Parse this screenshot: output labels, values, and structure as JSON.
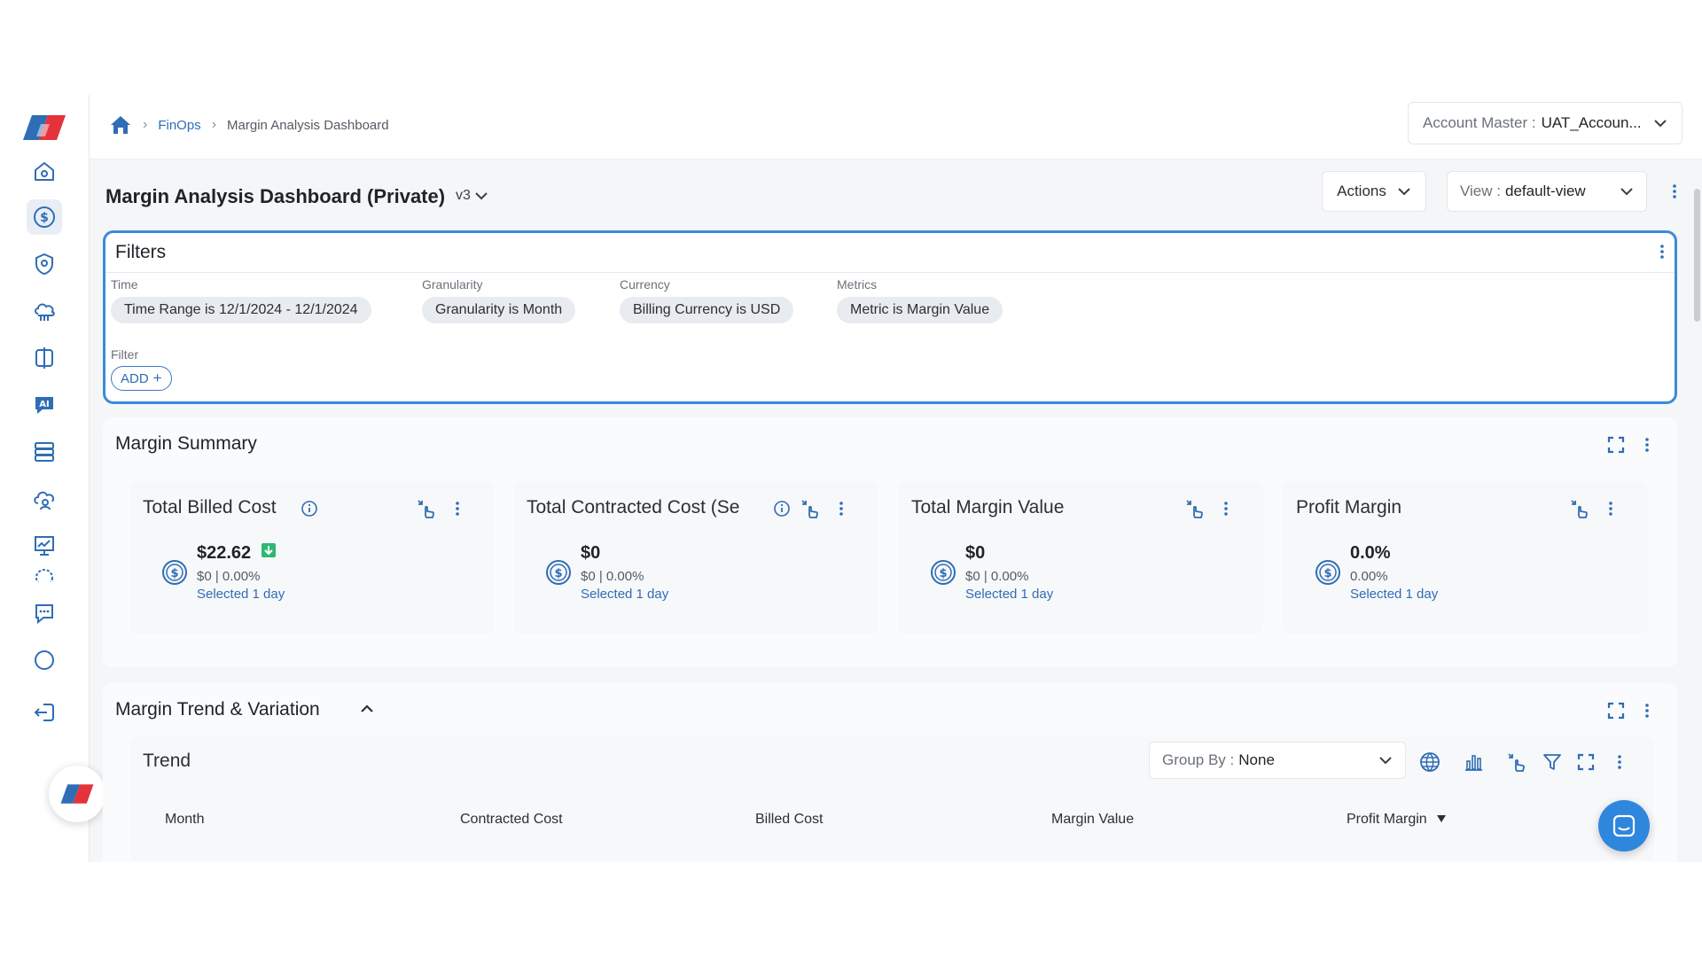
{
  "breadcrumb": {
    "items": [
      "FinOps",
      "Margin Analysis Dashboard"
    ]
  },
  "account": {
    "label": "Account Master :",
    "value": "UAT_Accoun..."
  },
  "page": {
    "title": "Margin Analysis Dashboard (Private)",
    "version": "v3"
  },
  "actions": {
    "label": "Actions"
  },
  "view": {
    "label": "View :",
    "value": "default-view"
  },
  "filters": {
    "title": "Filters",
    "groups": [
      {
        "label": "Time",
        "chip": "Time Range is 12/1/2024 - 12/1/2024"
      },
      {
        "label": "Granularity",
        "chip": "Granularity is Month"
      },
      {
        "label": "Currency",
        "chip": "Billing Currency is USD"
      },
      {
        "label": "Metrics",
        "chip": "Metric is Margin Value"
      }
    ],
    "filter_label": "Filter",
    "add_label": "ADD"
  },
  "summary": {
    "title": "Margin Summary",
    "cards": [
      {
        "title": "Total Billed Cost",
        "value": "$22.62",
        "sub": "$0 | 0.00%",
        "link": "Selected 1 day"
      },
      {
        "title": "Total Contracted Cost (Se",
        "value": "$0",
        "sub": "$0 | 0.00%",
        "link": "Selected 1 day"
      },
      {
        "title": "Total Margin Value",
        "value": "$0",
        "sub": "$0 | 0.00%",
        "link": "Selected 1 day"
      },
      {
        "title": "Profit Margin",
        "value": "0.0%",
        "sub": "0.00%",
        "link": "Selected 1 day"
      }
    ]
  },
  "trend_section": {
    "title": "Margin Trend & Variation",
    "trend_title": "Trend",
    "group_by": {
      "label": "Group By :",
      "value": "None"
    },
    "columns": [
      "Month",
      "Contracted Cost",
      "Billed Cost",
      "Margin Value",
      "Profit Margin"
    ]
  },
  "colors": {
    "accent": "#2f6db5",
    "focus_border": "#3b8ad9",
    "positive": "#2eb872"
  },
  "icons": [
    "home-icon",
    "dollar-icon",
    "shield-icon",
    "cloud-icon",
    "compare-icon",
    "ai-icon",
    "server-icon",
    "cloud-user-icon",
    "chart-icon",
    "settings-icon",
    "chat-icon",
    "user-icon",
    "logout-icon"
  ]
}
